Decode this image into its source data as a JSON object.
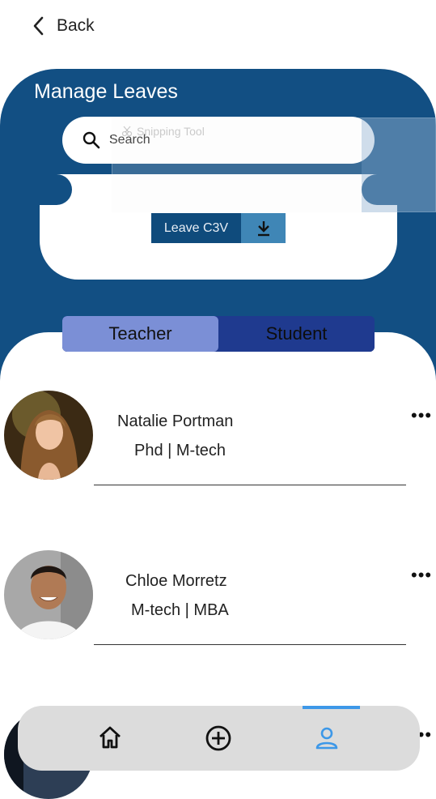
{
  "header": {
    "back_label": "Back",
    "title": "Manage Leaves"
  },
  "search": {
    "placeholder": "Search"
  },
  "overlay": {
    "snipping_tool_label": "Snipping Tool"
  },
  "leave_button": {
    "label": "Leave C3V"
  },
  "tabs": [
    {
      "label": "Teacher",
      "active": true
    },
    {
      "label": "Student",
      "active": false
    }
  ],
  "people": [
    {
      "name": "Natalie Portman",
      "degree": "Phd | M-tech"
    },
    {
      "name": "Chloe Morretz",
      "degree": "M-tech | MBA"
    },
    {
      "name": "",
      "degree": ""
    }
  ],
  "more_label": "•••",
  "nav": {
    "items": [
      "home-icon",
      "add-circle-icon",
      "profile-icon"
    ],
    "active_index": 2,
    "accent": "#3d98e8"
  },
  "colors": {
    "hero": "#124f83",
    "tab_active": "#7b8fd6",
    "tab_inactive": "#1f3a8f",
    "download": "#3f86b6"
  }
}
